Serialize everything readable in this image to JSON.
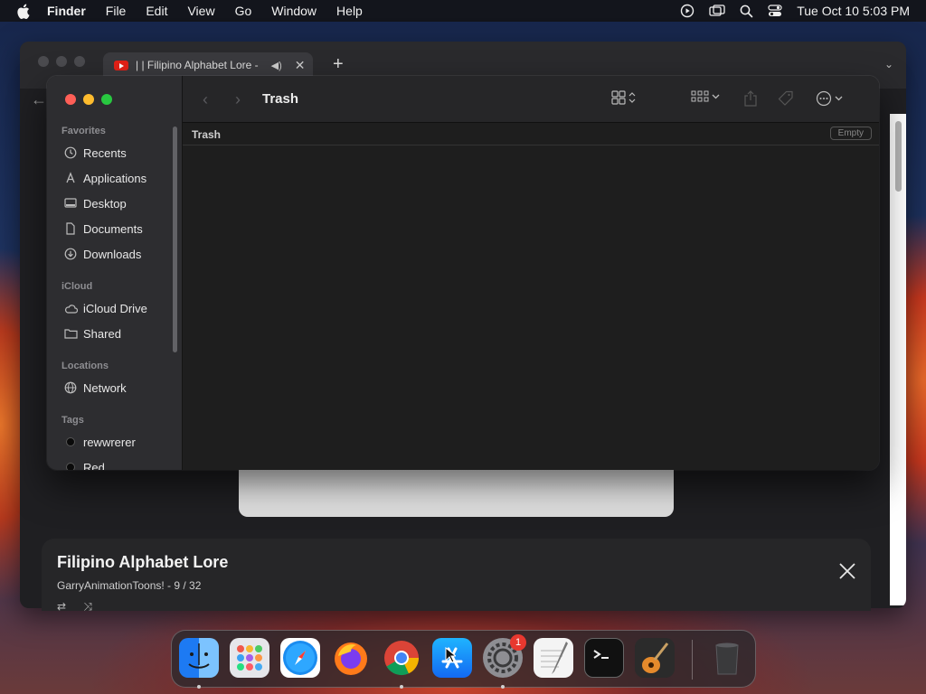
{
  "menubar": {
    "app_name": "Finder",
    "items": [
      "File",
      "Edit",
      "View",
      "Go",
      "Window",
      "Help"
    ],
    "clock": "Tue Oct 10  5:03 PM"
  },
  "browser": {
    "tab_title": "| | Filipino Alphabet Lore -",
    "new_tab": "+"
  },
  "mini_player": {
    "title": "Filipino Alphabet Lore",
    "subtitle": "GarryAnimationToons! - 9 / 32"
  },
  "finder": {
    "title": "Trash",
    "path_label": "Trash",
    "empty_button": "Empty",
    "sidebar": {
      "favorites_heading": "Favorites",
      "favorites": [
        "Recents",
        "Applications",
        "Desktop",
        "Documents",
        "Downloads"
      ],
      "icloud_heading": "iCloud",
      "icloud": [
        "iCloud Drive",
        "Shared"
      ],
      "locations_heading": "Locations",
      "locations": [
        "Network"
      ],
      "tags_heading": "Tags",
      "tags": [
        "rewwrerer",
        "Red"
      ]
    }
  },
  "dock": {
    "apps": [
      "Finder",
      "Launchpad",
      "Safari",
      "Firefox",
      "Chrome",
      "App Store",
      "System Settings",
      "TextEdit",
      "Terminal",
      "GarageBand",
      "Trash"
    ],
    "settings_badge": "1"
  },
  "colors": {
    "close": "#ff5f57",
    "minimize": "#febc2e",
    "zoom": "#28c840",
    "badge": "#e8382f"
  }
}
